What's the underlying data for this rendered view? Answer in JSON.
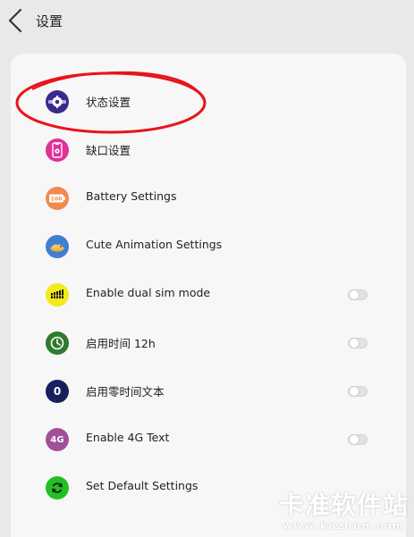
{
  "header": {
    "title": "设置",
    "back_icon": "chevron-left-icon"
  },
  "items": [
    {
      "label": "状态设置",
      "icon": "status-gear-icon",
      "icon_color": "#3a2a8a",
      "toggle": false
    },
    {
      "label": "缺口设置",
      "icon": "notch-phone-icon",
      "icon_color": "#e0309a",
      "toggle": false
    },
    {
      "label": "Battery Settings",
      "icon": "battery-icon",
      "icon_color": "#f08a50",
      "icon_text": "100",
      "toggle": false
    },
    {
      "label": "Cute Animation Settings",
      "icon": "animation-icon",
      "icon_color": "#3f7fd0",
      "toggle": false
    },
    {
      "label": "Enable dual sim mode",
      "icon": "dual-sim-signal-icon",
      "icon_color": "#f2ea1a",
      "toggle": true,
      "toggle_on": false
    },
    {
      "label": "启用时间 12h",
      "icon": "clock-icon",
      "icon_color": "#2f7a2f",
      "toggle": true,
      "toggle_on": false
    },
    {
      "label": "启用零时间文本",
      "icon": "zero-icon",
      "icon_color": "#16215c",
      "icon_text": "0",
      "toggle": true,
      "toggle_on": false
    },
    {
      "label": "Enable 4G Text",
      "icon": "4g-icon",
      "icon_color": "#a0509a",
      "icon_text": "4G",
      "toggle": true,
      "toggle_on": false
    },
    {
      "label": "Set Default Settings",
      "icon": "reset-icon",
      "icon_color": "#22c022",
      "toggle": false
    }
  ],
  "annotation": {
    "color": "#e8141c"
  },
  "watermark": {
    "main": "卡准软件站",
    "sub": "www.kazhun.com"
  }
}
